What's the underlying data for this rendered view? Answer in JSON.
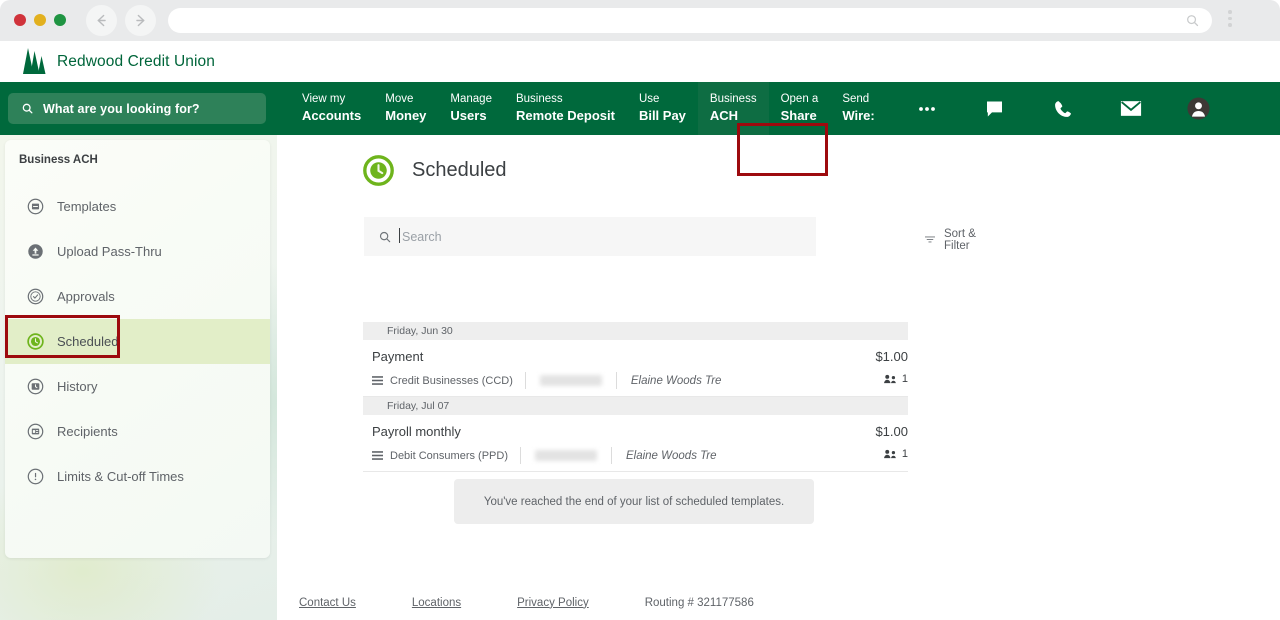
{
  "browser": {
    "url_value": "",
    "back_icon": "back-arrow-icon",
    "forward_icon": "forward-arrow-icon",
    "search_icon": "search-icon",
    "menu_icon": "kebab-menu-icon"
  },
  "brand": {
    "name": "Redwood Credit Union",
    "logo_icon": "redwood-tree-logo",
    "color": "#00653a"
  },
  "navbar": {
    "background": "#00693c",
    "search": {
      "placeholder": "What are you looking for?",
      "icon": "search-icon"
    },
    "items": [
      {
        "line1": "View my",
        "line2": "Accounts",
        "active": false
      },
      {
        "line1": "Move",
        "line2": "Money",
        "active": false
      },
      {
        "line1": "Manage",
        "line2": "Users",
        "active": false
      },
      {
        "line1": "Business",
        "line2": "Remote Deposit",
        "active": false
      },
      {
        "line1": "Use",
        "line2": "Bill Pay",
        "active": false
      },
      {
        "line1": "Business",
        "line2": "ACH",
        "active": true
      },
      {
        "line1": "Open a",
        "line2": "Share",
        "active": false
      },
      {
        "line1": "Send",
        "line2": "Wire:",
        "active": false
      }
    ],
    "icons": [
      {
        "name": "more-options-icon"
      },
      {
        "name": "chat-icon"
      },
      {
        "name": "phone-icon"
      },
      {
        "name": "mail-icon"
      },
      {
        "name": "user-avatar-icon"
      }
    ]
  },
  "annotations": {
    "color": "#9d0a0e",
    "nav_target": "Business ACH",
    "sidebar_target": "Scheduled"
  },
  "sidebar": {
    "title": "Business ACH",
    "active_color": "#e2eec8",
    "items": [
      {
        "label": "Templates",
        "icon": "list-circle-icon",
        "active": false
      },
      {
        "label": "Upload Pass-Thru",
        "icon": "upload-circle-icon",
        "active": false
      },
      {
        "label": "Approvals",
        "icon": "check-circle-icon",
        "active": false
      },
      {
        "label": "Scheduled",
        "icon": "clock-circle-icon",
        "active": true
      },
      {
        "label": "History",
        "icon": "history-circle-icon",
        "active": false
      },
      {
        "label": "Recipients",
        "icon": "card-circle-icon",
        "active": false
      },
      {
        "label": "Limits & Cut-off Times",
        "icon": "info-circle-icon",
        "active": false
      }
    ]
  },
  "main": {
    "title": "Scheduled",
    "title_icon": "clock-circle-icon",
    "title_icon_color": "#6eb41c",
    "search": {
      "placeholder": "Search",
      "value": "",
      "icon": "search-icon"
    },
    "sort_filter": {
      "label": "Sort & Filter",
      "icon": "filter-icon"
    },
    "groups": [
      {
        "date": "Friday, Jun 30",
        "rows": [
          {
            "name": "Payment",
            "kind": "Credit Businesses (CCD)",
            "kind_icon": "list-lines-icon",
            "redacted": true,
            "party": "Elaine Woods Tre",
            "amount": "$1.00",
            "count": "1",
            "count_icon": "people-icon"
          }
        ]
      },
      {
        "date": "Friday, Jul 07",
        "rows": [
          {
            "name": "Payroll monthly",
            "kind": "Debit Consumers (PPD)",
            "kind_icon": "list-lines-icon",
            "redacted": true,
            "party": "Elaine Woods Tre",
            "amount": "$1.00",
            "count": "1",
            "count_icon": "people-icon"
          }
        ]
      }
    ],
    "end_of_list": "You've reached the end of your list of scheduled templates."
  },
  "footer": {
    "links": [
      "Contact Us",
      "Locations",
      "Privacy Policy"
    ],
    "routing": "Routing # 321177586"
  }
}
